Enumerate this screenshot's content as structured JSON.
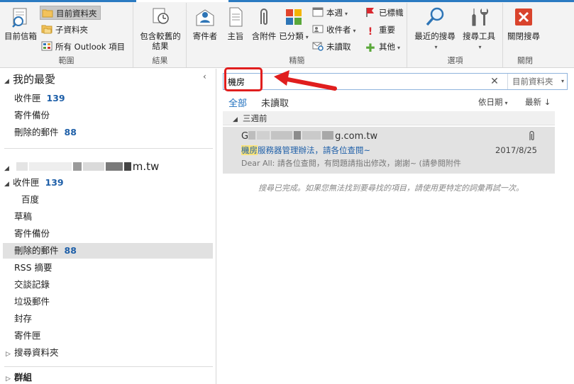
{
  "ribbon": {
    "groups": {
      "scope": {
        "label": "範圍",
        "current_mailbox": "目前信箱",
        "current_folder": "目前資料夾",
        "subfolders": "子資料夾",
        "all_outlook_items": "所有 Outlook 項目"
      },
      "results": {
        "label": "結果",
        "include_older": "包含較舊的結果"
      },
      "refine": {
        "label": "精簡",
        "from": "寄件者",
        "subject": "主旨",
        "has_attachments": "含附件",
        "categorized": "已分類",
        "this_week": "本週",
        "sent_to": "收件者",
        "unread": "未讀取",
        "flagged": "已標幟",
        "important": "重要",
        "more": "其他"
      },
      "options": {
        "label": "選項",
        "recent_searches": "最近的搜尋",
        "search_tools": "搜尋工具"
      },
      "close": {
        "label": "關閉",
        "close_search": "關閉搜尋"
      }
    }
  },
  "leftpane": {
    "favorites_title": "我的最愛",
    "favorites": [
      {
        "label": "收件匣",
        "count": "139"
      },
      {
        "label": "寄件備份",
        "count": ""
      },
      {
        "label": "刪除的郵件",
        "count": "88"
      }
    ],
    "account_suffix": "m.tw",
    "folders": [
      {
        "label": "收件匣",
        "count": "139"
      },
      {
        "label": "百度",
        "count": ""
      },
      {
        "label": "草稿",
        "count": ""
      },
      {
        "label": "寄件備份",
        "count": ""
      },
      {
        "label": "刪除的郵件",
        "count": "88"
      },
      {
        "label": "RSS 摘要",
        "count": ""
      },
      {
        "label": "交談記錄",
        "count": ""
      },
      {
        "label": "垃圾郵件",
        "count": ""
      },
      {
        "label": "封存",
        "count": ""
      },
      {
        "label": "寄件匣",
        "count": ""
      },
      {
        "label": "搜尋資料夾",
        "count": ""
      }
    ],
    "groups_label": "群組"
  },
  "search": {
    "query": "機房",
    "scope": "目前資料夾"
  },
  "filters": {
    "all": "全部",
    "unread": "未讀取",
    "sort_by": "依日期",
    "order": "最新"
  },
  "results": {
    "group_header": "三週前",
    "mail": {
      "from_start": "G",
      "from_end": "g.com.tw",
      "subject_highlight": "機房",
      "subject_rest": "服務器管理辦法，請各位查閱~",
      "date": "2017/8/25",
      "preview": "Dear All:  請各位查閱，有問題請指出修改，謝謝~  (請參閱附件"
    },
    "done_message": "搜尋已完成。如果您無法找到要尋找的項目，請使用更特定的詞彙再試一次。"
  }
}
